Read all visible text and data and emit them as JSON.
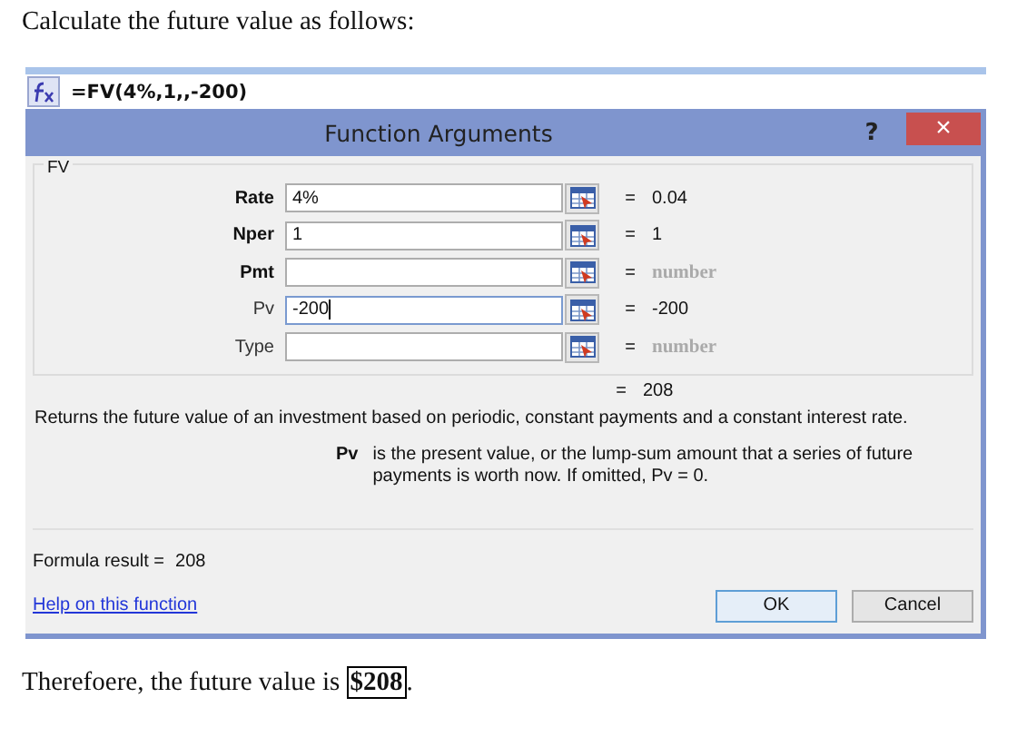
{
  "intro": "Calculate the future value as follows:",
  "formula_bar": {
    "formula": "=FV(4%,1,,-200)"
  },
  "dialog": {
    "title": "Function Arguments",
    "help_button": "?",
    "close_button": "×",
    "group_label": "FV",
    "arguments": [
      {
        "label": "Rate",
        "required": true,
        "value": "4%",
        "focused": false,
        "result": "0.04",
        "result_empty": false
      },
      {
        "label": "Nper",
        "required": true,
        "value": "1",
        "focused": false,
        "result": "1",
        "result_empty": false
      },
      {
        "label": "Pmt",
        "required": true,
        "focused": false,
        "result": "number",
        "result_empty": true
      },
      {
        "label": "Pv",
        "required": false,
        "value": "-200",
        "focused": true,
        "result": "-200",
        "result_empty": false
      },
      {
        "label": "Type",
        "required": false,
        "focused": false,
        "result": "number",
        "result_empty": true
      }
    ],
    "equals": "=",
    "total": "208",
    "description": "Returns the future value of an investment based on periodic, constant payments and a constant interest rate.",
    "argument_help": {
      "name": "Pv",
      "text": "is the present value, or the lump-sum amount that a series of future payments is worth now. If omitted, Pv = 0."
    },
    "formula_result_label": "Formula result =",
    "formula_result": "208",
    "help_link": "Help on this function",
    "buttons": [
      {
        "label": "OK",
        "default": true
      },
      {
        "label": "Cancel",
        "default": false
      }
    ]
  },
  "conclusion": "Therefoere, the future value is **$208**."
}
